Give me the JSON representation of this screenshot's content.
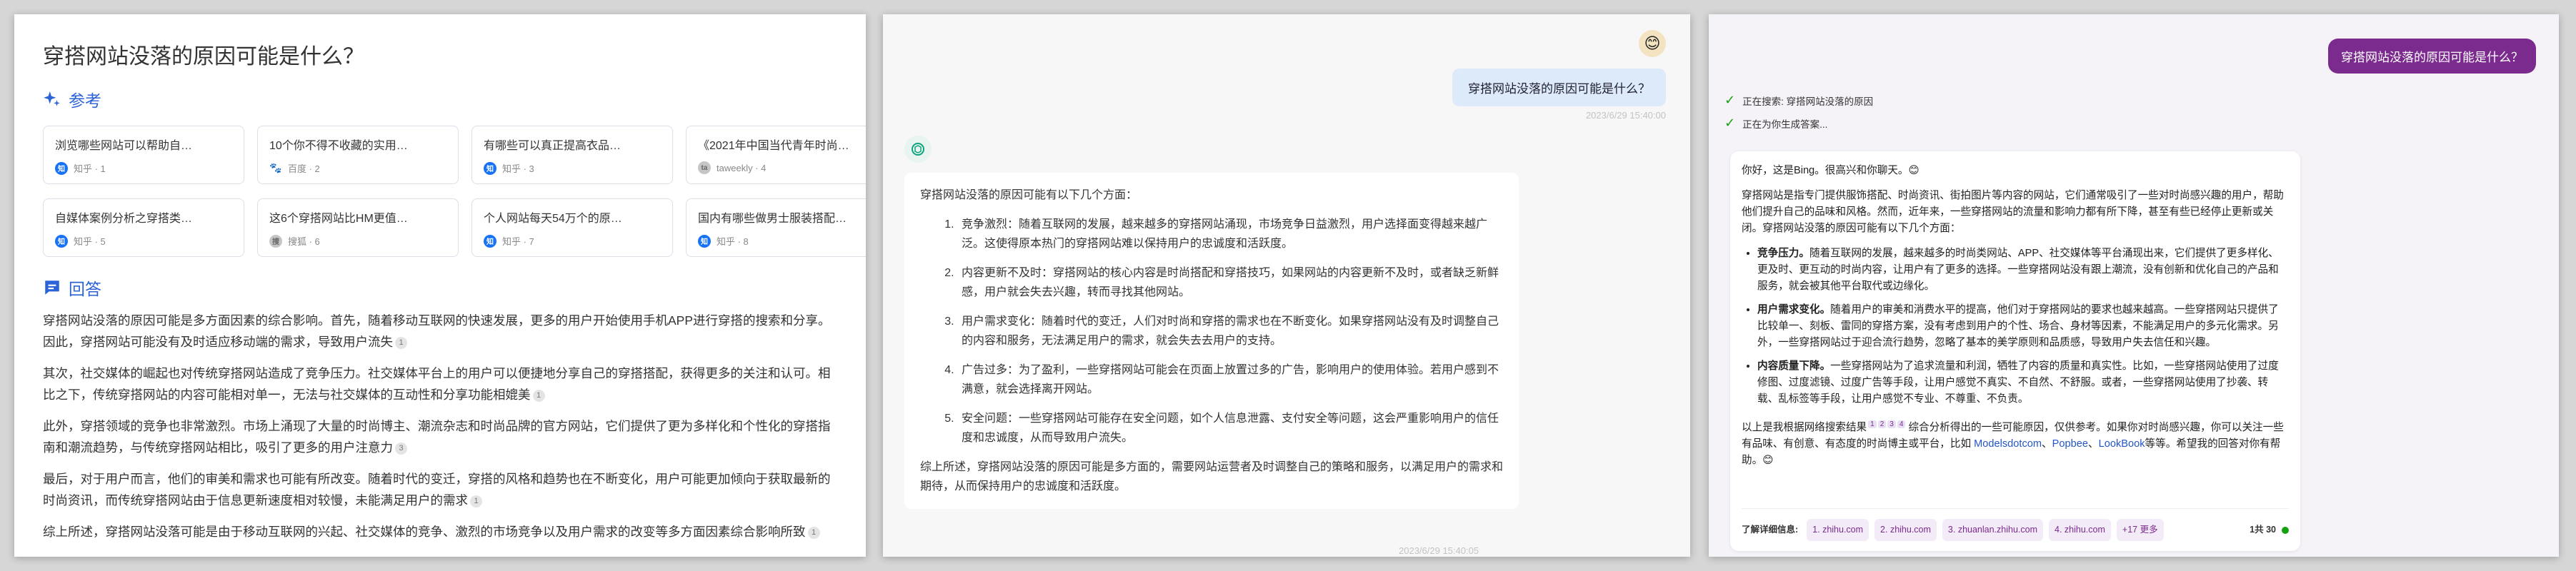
{
  "panel1": {
    "question": "穿搭网站没落的原因可能是什么？",
    "refs_label": "参考",
    "answer_label": "回答",
    "refs": [
      {
        "title": "浏览哪些网站可以帮助自…",
        "source": "知乎 · 1",
        "icon": "知",
        "type": "zhihu"
      },
      {
        "title": "10个你不得不收藏的实用…",
        "source": "百度 · 2",
        "icon": "🐾",
        "type": "baidu"
      },
      {
        "title": "有哪些可以真正提高衣品…",
        "source": "知乎 · 3",
        "icon": "知",
        "type": "zhihu"
      },
      {
        "title": "《2021年中国当代青年时尚…",
        "source": "taweekly · 4",
        "icon": "ta",
        "type": "gray"
      },
      {
        "title": "自媒体案例分析之穿搭类…",
        "source": "知乎 · 5",
        "icon": "知",
        "type": "zhihu"
      },
      {
        "title": "这6个穿搭网站比HM更值…",
        "source": "搜狐 · 6",
        "icon": "搜",
        "type": "gray"
      },
      {
        "title": "个人网站每天54万个的原…",
        "source": "知乎 · 7",
        "icon": "知",
        "type": "zhihu"
      },
      {
        "title": "国内有哪些做男士服装搭配…",
        "source": "知乎 · 8",
        "icon": "知",
        "type": "zhihu"
      }
    ],
    "paragraphs": [
      {
        "text": "穿搭网站没落的原因可能是多方面因素的综合影响。首先，随着移动互联网的快速发展，更多的用户开始使用手机APP进行穿搭的搜索和分享。因此，穿搭网站可能没有及时适应移动端的需求，导致用户流失",
        "cite": "1"
      },
      {
        "text": "其次，社交媒体的崛起也对传统穿搭网站造成了竞争压力。社交媒体平台上的用户可以便捷地分享自己的穿搭搭配，获得更多的关注和认可。相比之下，传统穿搭网站的内容可能相对单一，无法与社交媒体的互动性和分享功能相媲美",
        "cite": "1"
      },
      {
        "text": "此外，穿搭领域的竞争也非常激烈。市场上涌现了大量的时尚博主、潮流杂志和时尚品牌的官方网站，它们提供了更为多样化和个性化的穿搭指南和潮流趋势，与传统穿搭网站相比，吸引了更多的用户注意力",
        "cite": "3"
      },
      {
        "text": "最后，对于用户而言，他们的审美和需求也可能有所改变。随着时代的变迁，穿搭的风格和趋势也在不断变化，用户可能更加倾向于获取最新的时尚资讯，而传统穿搭网站由于信息更新速度相对较慢，未能满足用户的需求",
        "cite": "1"
      },
      {
        "text": "综上所述，穿搭网站没落可能是由于移动互联网的兴起、社交媒体的竞争、激烈的市场竞争以及用户需求的改变等多方面因素综合影响所致",
        "cite": "1"
      }
    ]
  },
  "panel2": {
    "user_message": "穿搭网站没落的原因可能是什么？",
    "user_timestamp": "2023/6/29 15:40:00",
    "bot_timestamp": "2023/6/29 15:40:05",
    "intro": "穿搭网站没落的原因可能有以下几个方面：",
    "items": [
      "竞争激烈：随着互联网的发展，越来越多的穿搭网站涌现，市场竞争日益激烈，用户选择面变得越来越广泛。这使得原本热门的穿搭网站难以保持用户的忠诚度和活跃度。",
      "内容更新不及时：穿搭网站的核心内容是时尚搭配和穿搭技巧，如果网站的内容更新不及时，或者缺乏新鲜感，用户就会失去兴趣，转而寻找其他网站。",
      "用户需求变化：随着时代的变迁，人们对时尚和穿搭的需求也在不断变化。如果穿搭网站没有及时调整自己的内容和服务，无法满足用户的需求，就会失去去用户的支持。",
      "广告过多：为了盈利，一些穿搭网站可能会在页面上放置过多的广告，影响用户的使用体验。若用户感到不满意，就会选择离开网站。",
      "安全问题：一些穿搭网站可能存在安全问题，如个人信息泄露、支付安全等问题，这会严重影响用户的信任度和忠诚度，从而导致用户流失。"
    ],
    "outro": "综上所述，穿搭网站没落的原因可能是多方面的，需要网站运营者及时调整自己的策略和服务，以满足用户的需求和期待，从而保持用户的忠诚度和活跃度。"
  },
  "panel3": {
    "user_message": "穿搭网站没落的原因可能是什么？",
    "status_search": "正在搜索: 穿搭网站没落的原因",
    "status_generating": "正在为你生成答案...",
    "greeting": "你好，这是Bing。很高兴和你聊天。😊",
    "para1": "穿搭网站是指专门提供服饰搭配、时尚资讯、街拍图片等内容的网站，它们通常吸引了一些对时尚感兴趣的用户，帮助他们提升自己的品味和风格。然而，近年来，一些穿搭网站的流量和影响力都有所下降，甚至有些已经停止更新或关闭。穿搭网站没落的原因可能有以下几个方面：",
    "bullets": [
      {
        "bold": "竞争压力。",
        "text": "随着互联网的发展，越来越多的时尚类网站、APP、社交媒体等平台涌现出来，它们提供了更多样化、更及时、更互动的时尚内容，让用户有了更多的选择。一些穿搭网站没有跟上潮流，没有创新和优化自己的产品和服务，就会被其他平台取代或边缘化。"
      },
      {
        "bold": "用户需求变化。",
        "text": "随着用户的审美和消费水平的提高，他们对于穿搭网站的要求也越来越高。一些穿搭网站只提供了比较单一、刻板、雷同的穿搭方案，没有考虑到用户的个性、场合、身材等因素，不能满足用户的多元化需求。另外，一些穿搭网站过于迎合流行趋势，忽略了基本的美学原则和品质感，导致用户失去信任和兴趣。"
      },
      {
        "bold": "内容质量下降。",
        "text": "一些穿搭网站为了追求流量和利润，牺牲了内容的质量和真实性。比如，一些穿搭网站使用了过度修图、过度滤镜、过度广告等手段，让用户感觉不真实、不自然、不舒服。或者，一些穿搭网站使用了抄袭、转载、乱标签等手段，让用户感觉不专业、不尊重、不负责。"
      }
    ],
    "sources_line_a": "以上是我根据网络搜索结果",
    "sources_line_b": "综合分析得出的一些可能原因，仅供参考。如果你对时尚感兴趣，你可以关注一些有品味、有创意、有态度的时尚博主或平台，比如",
    "links": [
      "Modelsdotcom",
      "Popbee",
      "LookBook"
    ],
    "sources_line_c": "等等。希望我的回答对你有帮助。😊",
    "sup_nums": [
      "1",
      "2",
      "3",
      "4"
    ],
    "more_info_label": "了解详细信息:",
    "chips": [
      "1. zhihu.com",
      "2. zhihu.com",
      "3. zhuanlan.zhihu.com",
      "4. zhihu.com",
      "+17 更多"
    ],
    "count": "1共 30"
  }
}
